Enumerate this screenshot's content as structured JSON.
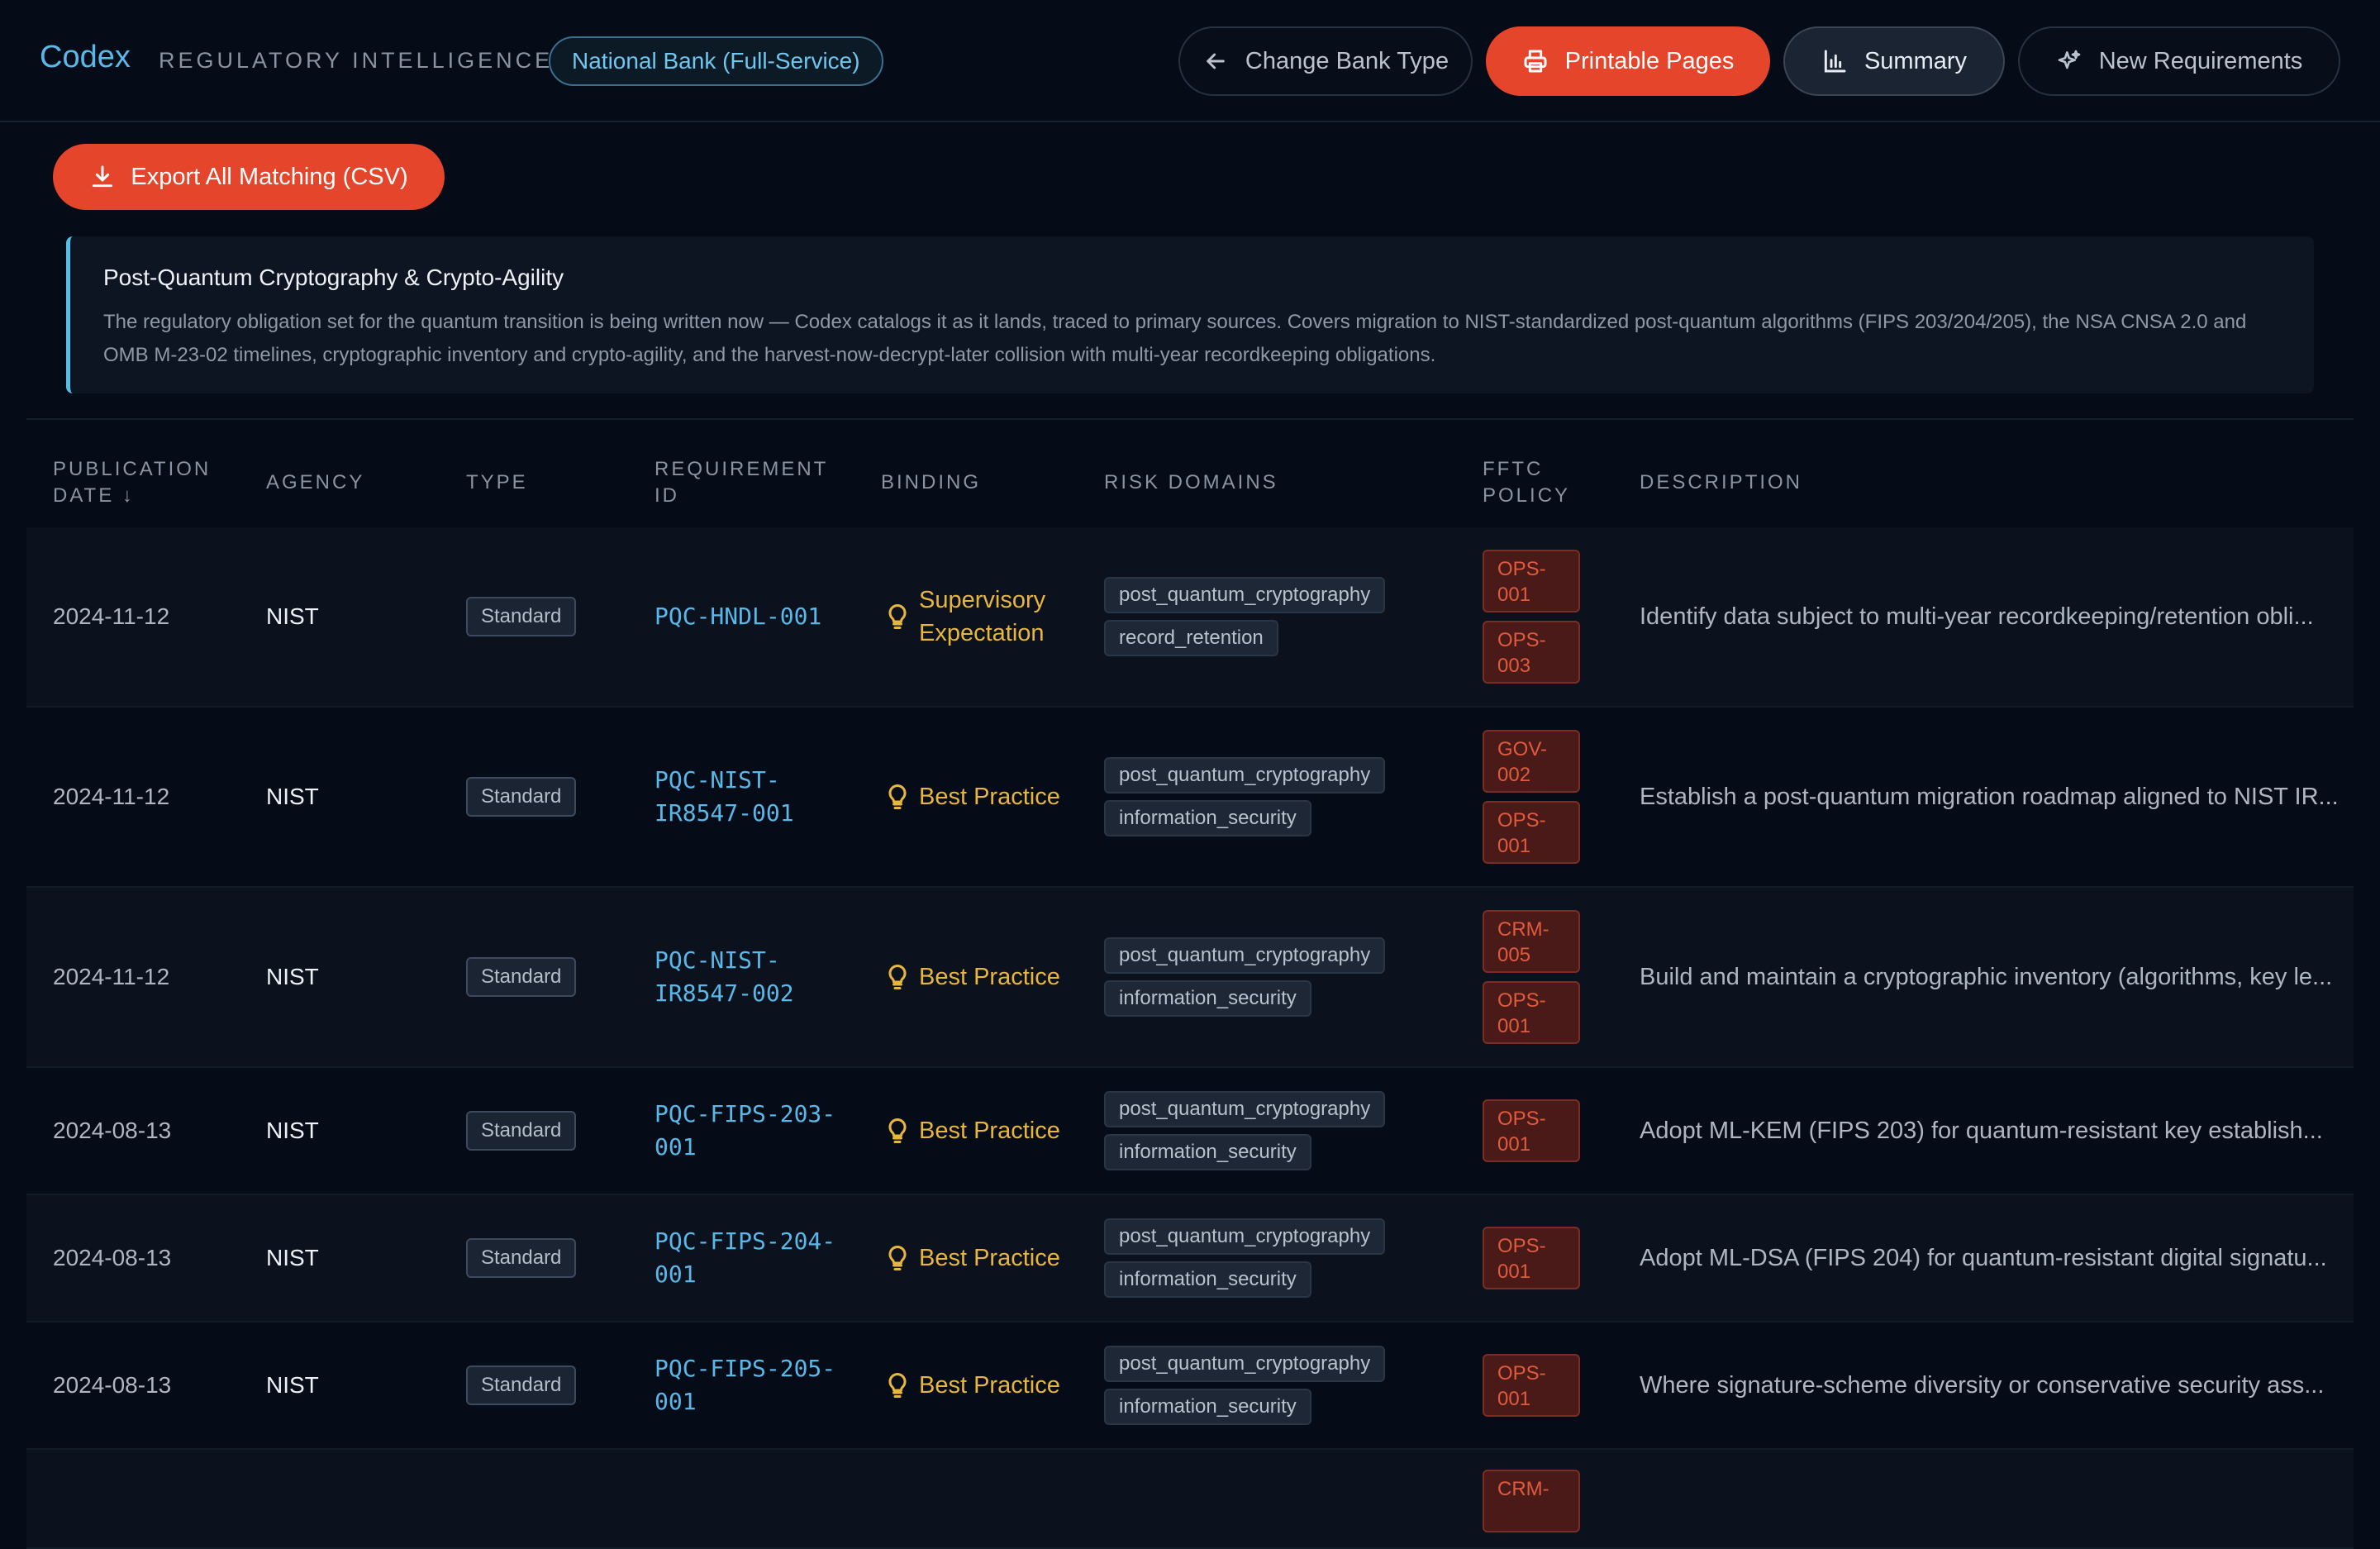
{
  "header": {
    "brand": "Codex",
    "subtitle": "REGULATORY INTELLIGENCE",
    "bank_type": "National Bank (Full-Service)",
    "buttons": {
      "change_bank_type": "Change Bank Type",
      "printable_pages": "Printable Pages",
      "summary": "Summary",
      "new_requirements": "New Requirements"
    }
  },
  "export_button": "Export All Matching (CSV)",
  "banner": {
    "title": "Post-Quantum Cryptography & Crypto-Agility",
    "text": "The regulatory obligation set for the quantum transition is being written now — Codex catalogs it as it lands, traced to primary sources. Covers migration to NIST-standardized post-quantum algorithms (FIPS 203/204/205), the NSA CNSA 2.0 and OMB M-23-02 timelines, cryptographic inventory and crypto-agility, and the harvest-now-decrypt-later collision with multi-year recordkeeping obligations."
  },
  "table": {
    "headers": {
      "publication_date": "PUBLICATION DATE ↓",
      "agency": "AGENCY",
      "type": "TYPE",
      "requirement_id": "REQUIREMENT ID",
      "binding": "BINDING",
      "risk_domains": "RISK DOMAINS",
      "fftc_policy": "FFTC POLICY",
      "description": "DESCRIPTION"
    },
    "rows": [
      {
        "date": "2024-11-12",
        "agency": "NIST",
        "type": "Standard",
        "req_id": "PQC-HNDL-001",
        "binding": "Supervisory Expectation",
        "risk": [
          "post_quantum_cryptography",
          "record_retention"
        ],
        "fftc": [
          "OPS-001",
          "OPS-003"
        ],
        "description": "Identify data subject to multi-year recordkeeping/retention obli..."
      },
      {
        "date": "2024-11-12",
        "agency": "NIST",
        "type": "Standard",
        "req_id": "PQC-NIST-IR8547-001",
        "binding": "Best Practice",
        "risk": [
          "post_quantum_cryptography",
          "information_security"
        ],
        "fftc": [
          "GOV-002",
          "OPS-001"
        ],
        "description": "Establish a post-quantum migration roadmap aligned to NIST IR..."
      },
      {
        "date": "2024-11-12",
        "agency": "NIST",
        "type": "Standard",
        "req_id": "PQC-NIST-IR8547-002",
        "binding": "Best Practice",
        "risk": [
          "post_quantum_cryptography",
          "information_security"
        ],
        "fftc": [
          "CRM-005",
          "OPS-001"
        ],
        "description": "Build and maintain a cryptographic inventory (algorithms, key le..."
      },
      {
        "date": "2024-08-13",
        "agency": "NIST",
        "type": "Standard",
        "req_id": "PQC-FIPS-203-001",
        "binding": "Best Practice",
        "risk": [
          "post_quantum_cryptography",
          "information_security"
        ],
        "fftc": [
          "OPS-001"
        ],
        "description": "Adopt ML-KEM (FIPS 203) for quantum-resistant key establish..."
      },
      {
        "date": "2024-08-13",
        "agency": "NIST",
        "type": "Standard",
        "req_id": "PQC-FIPS-204-001",
        "binding": "Best Practice",
        "risk": [
          "post_quantum_cryptography",
          "information_security"
        ],
        "fftc": [
          "OPS-001"
        ],
        "description": "Adopt ML-DSA (FIPS 204) for quantum-resistant digital signatu..."
      },
      {
        "date": "2024-08-13",
        "agency": "NIST",
        "type": "Standard",
        "req_id": "PQC-FIPS-205-001",
        "binding": "Best Practice",
        "risk": [
          "post_quantum_cryptography",
          "information_security"
        ],
        "fftc": [
          "OPS-001"
        ],
        "description": "Where signature-scheme diversity or conservative security ass..."
      },
      {
        "date": "",
        "agency": "",
        "type": "",
        "req_id": "",
        "binding": "",
        "risk": [],
        "fftc": [
          "CRM-"
        ],
        "description": ""
      }
    ]
  },
  "colors": {
    "accent_blue": "#5ab8e8",
    "accent_orange": "#e5452b",
    "binding_yellow": "#e8b63d",
    "fftc_red": "#e05b3d"
  },
  "icons": {
    "change_bank_type": "arrow-left-icon",
    "printable_pages": "printer-icon",
    "summary": "bar-chart-icon",
    "new_requirements": "sparkles-icon",
    "export": "download-icon",
    "binding": "lightbulb-icon"
  }
}
